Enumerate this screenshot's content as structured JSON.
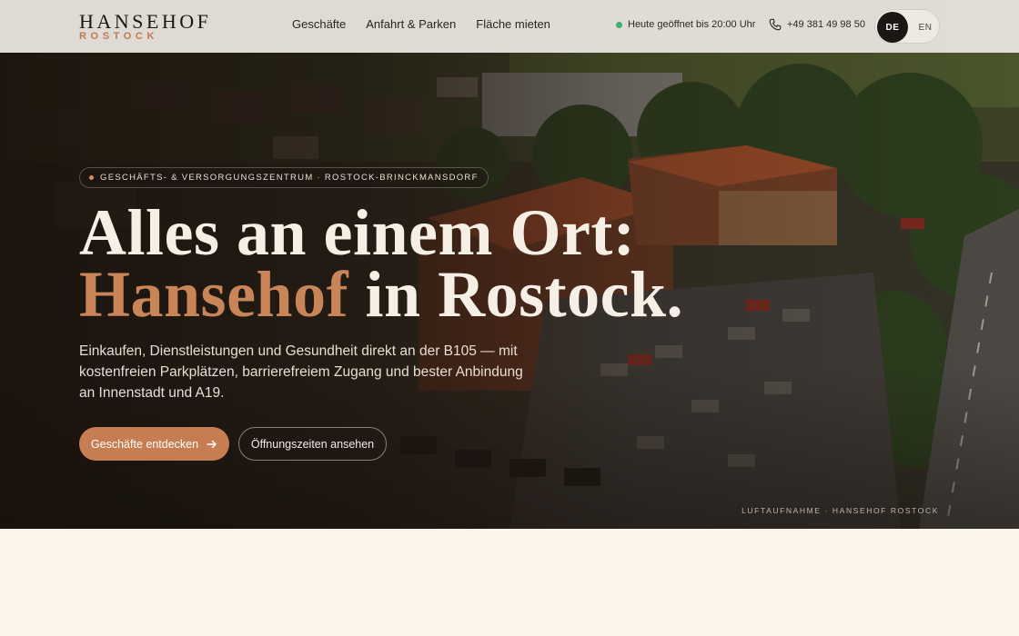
{
  "brand": {
    "name": "HANSEHOF",
    "city": "ROSTOCK"
  },
  "nav": [
    {
      "label": "Geschäfte"
    },
    {
      "label": "Anfahrt & Parken"
    },
    {
      "label": "Fläche mieten"
    }
  ],
  "status": {
    "text": "Heute geöffnet bis 20:00 Uhr",
    "color": "#3fb070"
  },
  "phone": {
    "number": "+49 381 49 98 50",
    "icon": "phone-icon"
  },
  "language": {
    "active": "DE",
    "inactive": "EN"
  },
  "hero": {
    "eyebrow": "GESCHÄFTS- & VERSORGUNGSZENTRUM · ROSTOCK-BRINCKMANSDORF",
    "headline_line1": "Alles an einem Ort:",
    "headline_accent": "Hansehof",
    "headline_line2_rest": " in Rostock.",
    "lead": "Einkaufen, Dienstleistungen und Gesundheit direkt an der B105 — mit kostenfreien Parkplätzen, barrierefreiem Zugang und bester Anbindung an Innenstadt und A19.",
    "primary_button": "Geschäfte entdecken",
    "secondary_button": "Öffnungszeiten ansehen",
    "caption": "LUFTAUFNAHME · HANSEHOF ROSTOCK"
  },
  "colors": {
    "accent": "#c67d51",
    "dark": "#1c1713",
    "page_bg": "#fcf3ea"
  }
}
